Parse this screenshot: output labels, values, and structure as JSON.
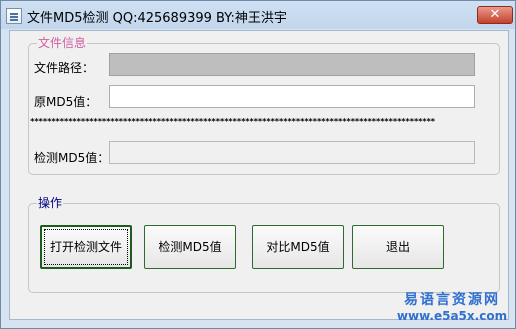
{
  "window": {
    "title": "文件MD5检测   QQ:425689399 BY:神王洪宇",
    "close_label": "✕"
  },
  "file_group": {
    "title": "文件信息",
    "path_label": "文件路径：",
    "path_value": "",
    "orig_md5_label": "原MD5值：",
    "orig_md5_value": "",
    "separator": "************************************************************************************************",
    "detected_md5_label": "检测MD5值：",
    "detected_md5_value": ""
  },
  "ops_group": {
    "title": "操作",
    "buttons": [
      {
        "label": "打开检测文件"
      },
      {
        "label": "检测MD5值"
      },
      {
        "label": "对比MD5值"
      },
      {
        "label": "退出"
      }
    ]
  },
  "watermark": {
    "line1": "易语言资源网",
    "line2": "www.e5a5x.com"
  },
  "colors": {
    "file_group_title": "#d060a0",
    "ops_group_title": "#000080",
    "button_border": "#2f6b2f",
    "watermark": "#3070d0"
  }
}
